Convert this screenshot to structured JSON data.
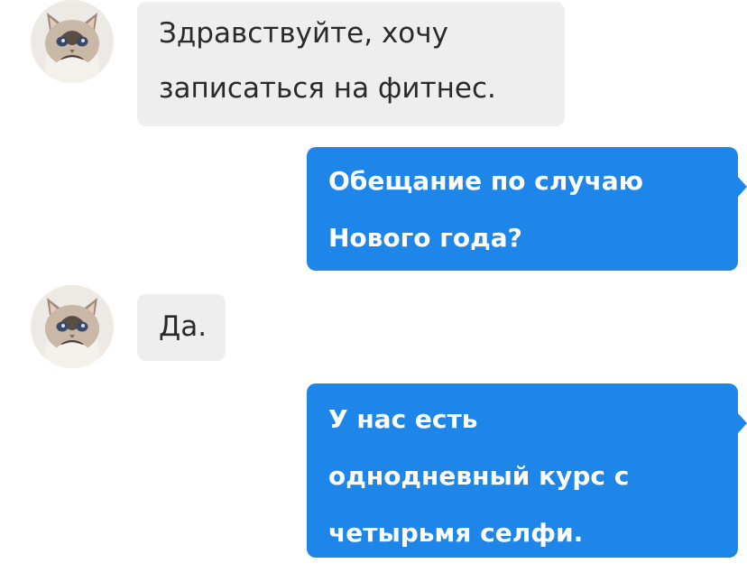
{
  "colors": {
    "incoming_bubble": "#eeeeee",
    "outgoing_bubble": "#1d86e8",
    "incoming_text": "#2a2a2a",
    "outgoing_text": "#ffffff"
  },
  "contact": {
    "avatar_icon": "grumpy-cat-avatar"
  },
  "messages": [
    {
      "direction": "incoming",
      "text": "Здравствуйте, хочу\nзаписаться на фитнес."
    },
    {
      "direction": "outgoing",
      "text": "Обещание по случаю\nНового года?"
    },
    {
      "direction": "incoming",
      "text": "Да."
    },
    {
      "direction": "outgoing",
      "text": "У нас есть\nоднодневный курс с\nчетырьмя селфи."
    }
  ]
}
